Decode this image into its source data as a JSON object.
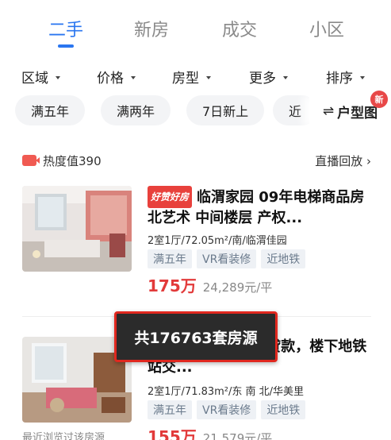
{
  "tabs": [
    {
      "label": "二手",
      "active": true
    },
    {
      "label": "新房",
      "active": false
    },
    {
      "label": "成交",
      "active": false
    },
    {
      "label": "小区",
      "active": false
    }
  ],
  "filters": [
    "区域",
    "价格",
    "房型",
    "更多",
    "排序"
  ],
  "chips": [
    "满五年",
    "满两年",
    "7日新上",
    "近"
  ],
  "layout_button": {
    "label": "户型图",
    "badge": "新",
    "icon": "swap-arrows-icon"
  },
  "live": {
    "heat_text": "热度值390",
    "replay_text": "直播回放",
    "icon": "live-video-icon"
  },
  "listings": [
    {
      "badge": "好赞好房",
      "title": "临渭家园 09年电梯商品房 北艺术 中间楼层 产权...",
      "meta": "2室1厅/72.05m²/南/临渭佳园",
      "tags": [
        "满五年",
        "VR看装修",
        "近地铁"
      ],
      "price_total": "175万",
      "price_unit": "24,289元/平"
    },
    {
      "badge": "",
      "title": "长虹公园旁 私产可贷款，楼下地铁站交...",
      "meta": "2室1厅/71.83m²/东 南 北/华美里",
      "tags": [
        "满五年",
        "VR看装修",
        "近地铁"
      ],
      "price_total": "155万",
      "price_unit": "21,579元/平"
    }
  ],
  "toast": "共176763套房源",
  "recent_label": "最近浏览过该房源",
  "colors": {
    "accent": "#2a76f0",
    "price": "#e23a3a",
    "toast_border": "#e0281f"
  }
}
